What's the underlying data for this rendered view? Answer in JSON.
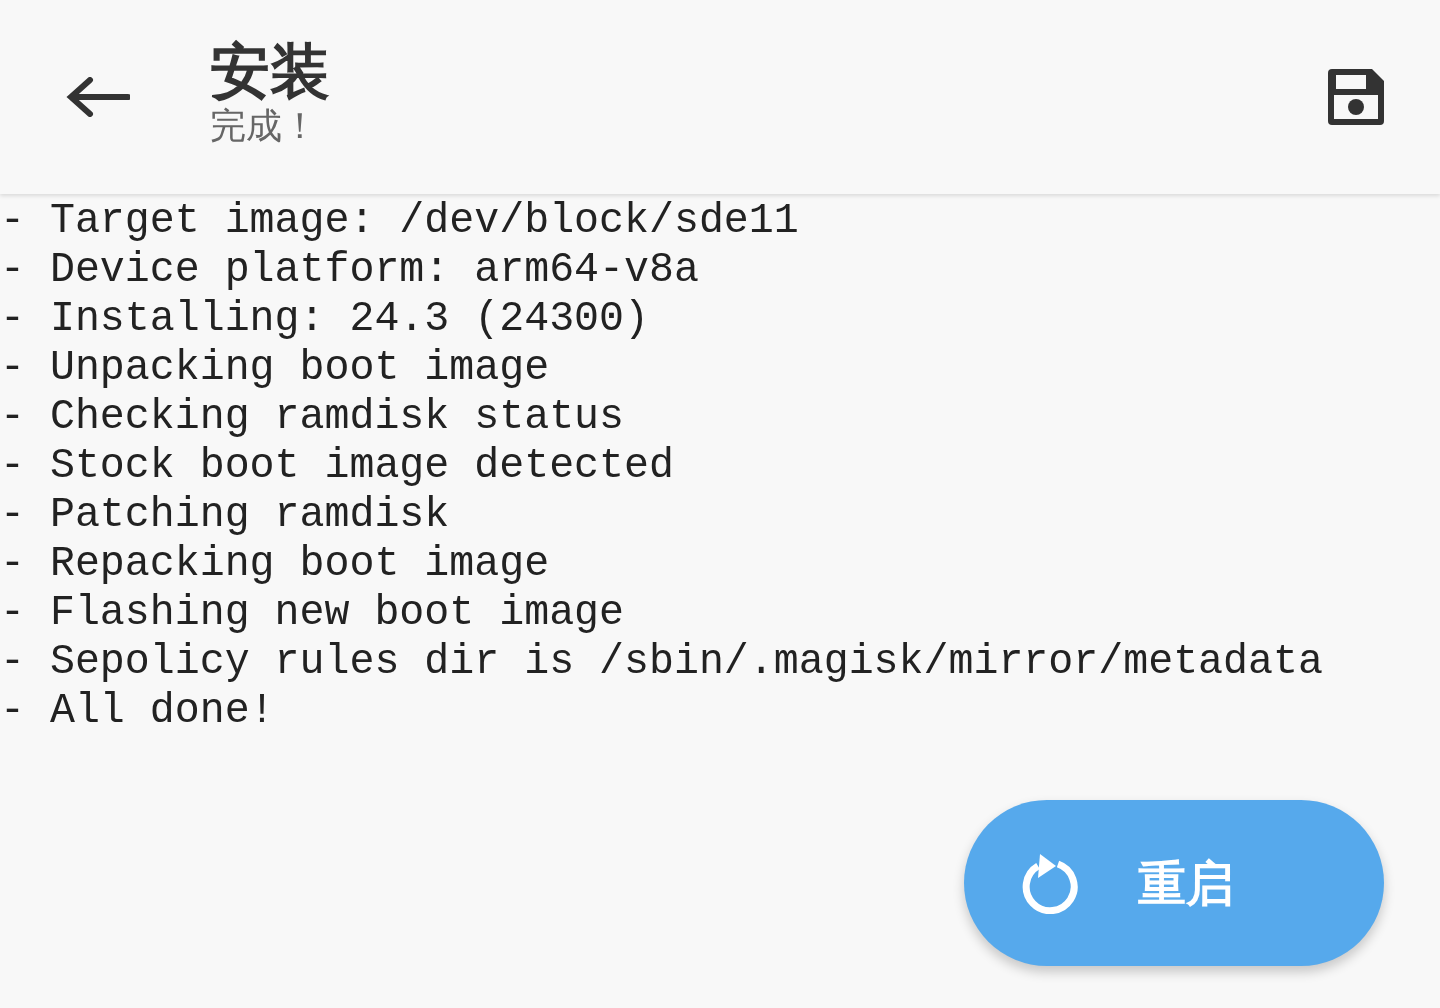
{
  "app_bar": {
    "title": "安装",
    "subtitle": "完成！"
  },
  "log_lines": [
    "- Target image: /dev/block/sde11",
    "- Device platform: arm64-v8a",
    "- Installing: 24.3 (24300)",
    "- Unpacking boot image",
    "- Checking ramdisk status",
    "- Stock boot image detected",
    "- Patching ramdisk",
    "- Repacking boot image",
    "- Flashing new boot image",
    "- Sepolicy rules dir is /sbin/.magisk/mirror/metadata",
    "- All done!"
  ],
  "fab": {
    "label": "重启"
  }
}
